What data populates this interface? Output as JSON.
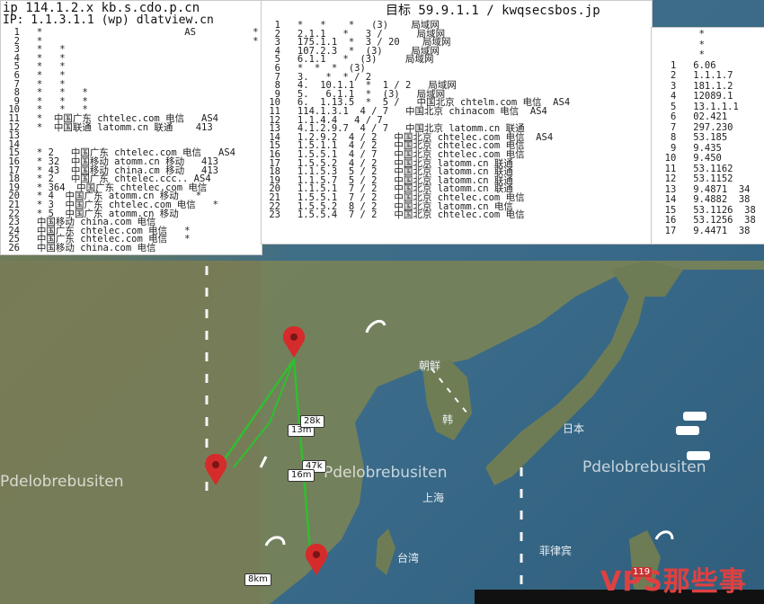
{
  "windows": [
    {
      "title": "ip 114.1.2.x  kb.s.cdo.p.cn",
      "subtitle": "IP: 1.1.3.1.1  (wp) dlatview.cn",
      "lines": [
        "  1   *                         AS          * *",
        "  2   *                                     *",
        "  3   *   *",
        "  4   *   *",
        "  5   *   *",
        "  6   *   *",
        "  7   *   *",
        "  8   *   *   *",
        "  9   *   *   *",
        " 10   *   *   *",
        " 11   *  中国广东 chtelec.com 电信   AS4",
        " 12   *  中国联通 latomm.cn 联通    413",
        " 13",
        " 14",
        " 15   * 2   中国广东 chtelec.com 电信   AS4",
        " 16   * 32  中国移动 atomm.cn 移动   413",
        " 17   * 43  中国移动 china.cm 移动   413",
        " 18   * 2   中国广东 chtelec.ccc.. AS4",
        " 19   * 364  中国广东 chtelec.com 电信",
        " 20   * 4  中国广东 atomm.cn 移动   *",
        " 21   * 3  中国广东 chtelec.com 电信   *",
        " 22   * 5  中国广东 atomm.cn 移动",
        " 23   中国移动 china.com 电信",
        " 24   中国广东 chtelec.com 电信   *",
        " 25   中国广东 chtelec.com 电信   *",
        " 26   中国移动 china.com 电信"
      ]
    },
    {
      "title": "目标 59.9.1.1 / kwqsecsbos.jp",
      "subtitle": "",
      "lines": [
        "  1   *   *    *   (3)    局域网",
        "  2   2.1.1   *   3 /      局域网",
        "  3   175.1.1  *  3 / 20    局域网",
        "  4   107.2.3  *  (3)     局域网",
        "  5   6.1.1   *  (3)     局域网",
        "  6   *  *  *  (3)",
        "  7   3.   *  * / 2",
        "  8   4.  10.1.1  *  1 / 2   局域网",
        "  9   5.   6.1.1  *  (3)   局域网",
        " 10   6.  1.13.5  *  5 /   中国北京 chtelm.com 电信  AS4",
        " 11   114.1.3.1  4 / 7   中国北京 chinacom 电信  AS4",
        " 12   1.1.4.4   4 / 7",
        " 13   4.1.2.9.7  4 / 7   中国北京 latomm.cn 联通",
        " 14   1.2.9.2  4 / 2   中国北京 chtelec.com 电信  AS4",
        " 15   1.5.1.1  4 / 2   中国北京 chtelec.com 电信",
        " 16   1.5.5.1  4 / 7   中国北京 chtelec.com 电信",
        " 17   1.5.5.2  4 / 2   中国北京 latomm.cn 联通",
        " 18   1.1.5.3  5 / 2   中国北京 latomm.cn 联通",
        " 19   1.1.5.7  5 / 2   中国北京 latomm.cn 联通",
        " 20   1.1.5.1  7 / 2   中国北京 latomm.cn 联通",
        " 21   1.5.5.1  7 / 2   中国北京 chtelec.com 电信",
        " 22   1.5.5.2  8 / 2   中国北京 latomm.cn 电信",
        " 23   1.5.5.4  7 / 2   中国北京 chtelec.com 电信"
      ]
    },
    {
      "title": "",
      "subtitle": "",
      "lines": [
        "        *",
        "        *",
        "        *",
        "   1   6.06",
        "   2   1.1.1.7",
        "   3   181.1.2",
        "   4   12089.1",
        "   5   13.1.1.1",
        "   6   02.421",
        "   7   297.230",
        "   8   53.185",
        "   9   9.435",
        "  10   9.450",
        "  11   53.1162",
        "  12   53.1152",
        "  13   9.4871  34",
        "  14   9.4882  38",
        "  15   53.1126  38",
        "  16   53.1256  38",
        "  17   9.4471  38"
      ]
    }
  ],
  "map": {
    "watermark": "Pdelobrebusiten",
    "distances": [
      "13m",
      "28k",
      "47k",
      "16m",
      "8km"
    ],
    "places": [
      "朝鲜",
      "韩",
      "日本",
      "上海",
      "台湾",
      "菲律宾"
    ]
  },
  "branding": {
    "logo_text": "VPS那些事",
    "badge": "119"
  },
  "colors": {
    "route": "#2fbf2f",
    "pin": "#d62b2b",
    "ocean": "#3a6a89",
    "land": "#77845c"
  }
}
